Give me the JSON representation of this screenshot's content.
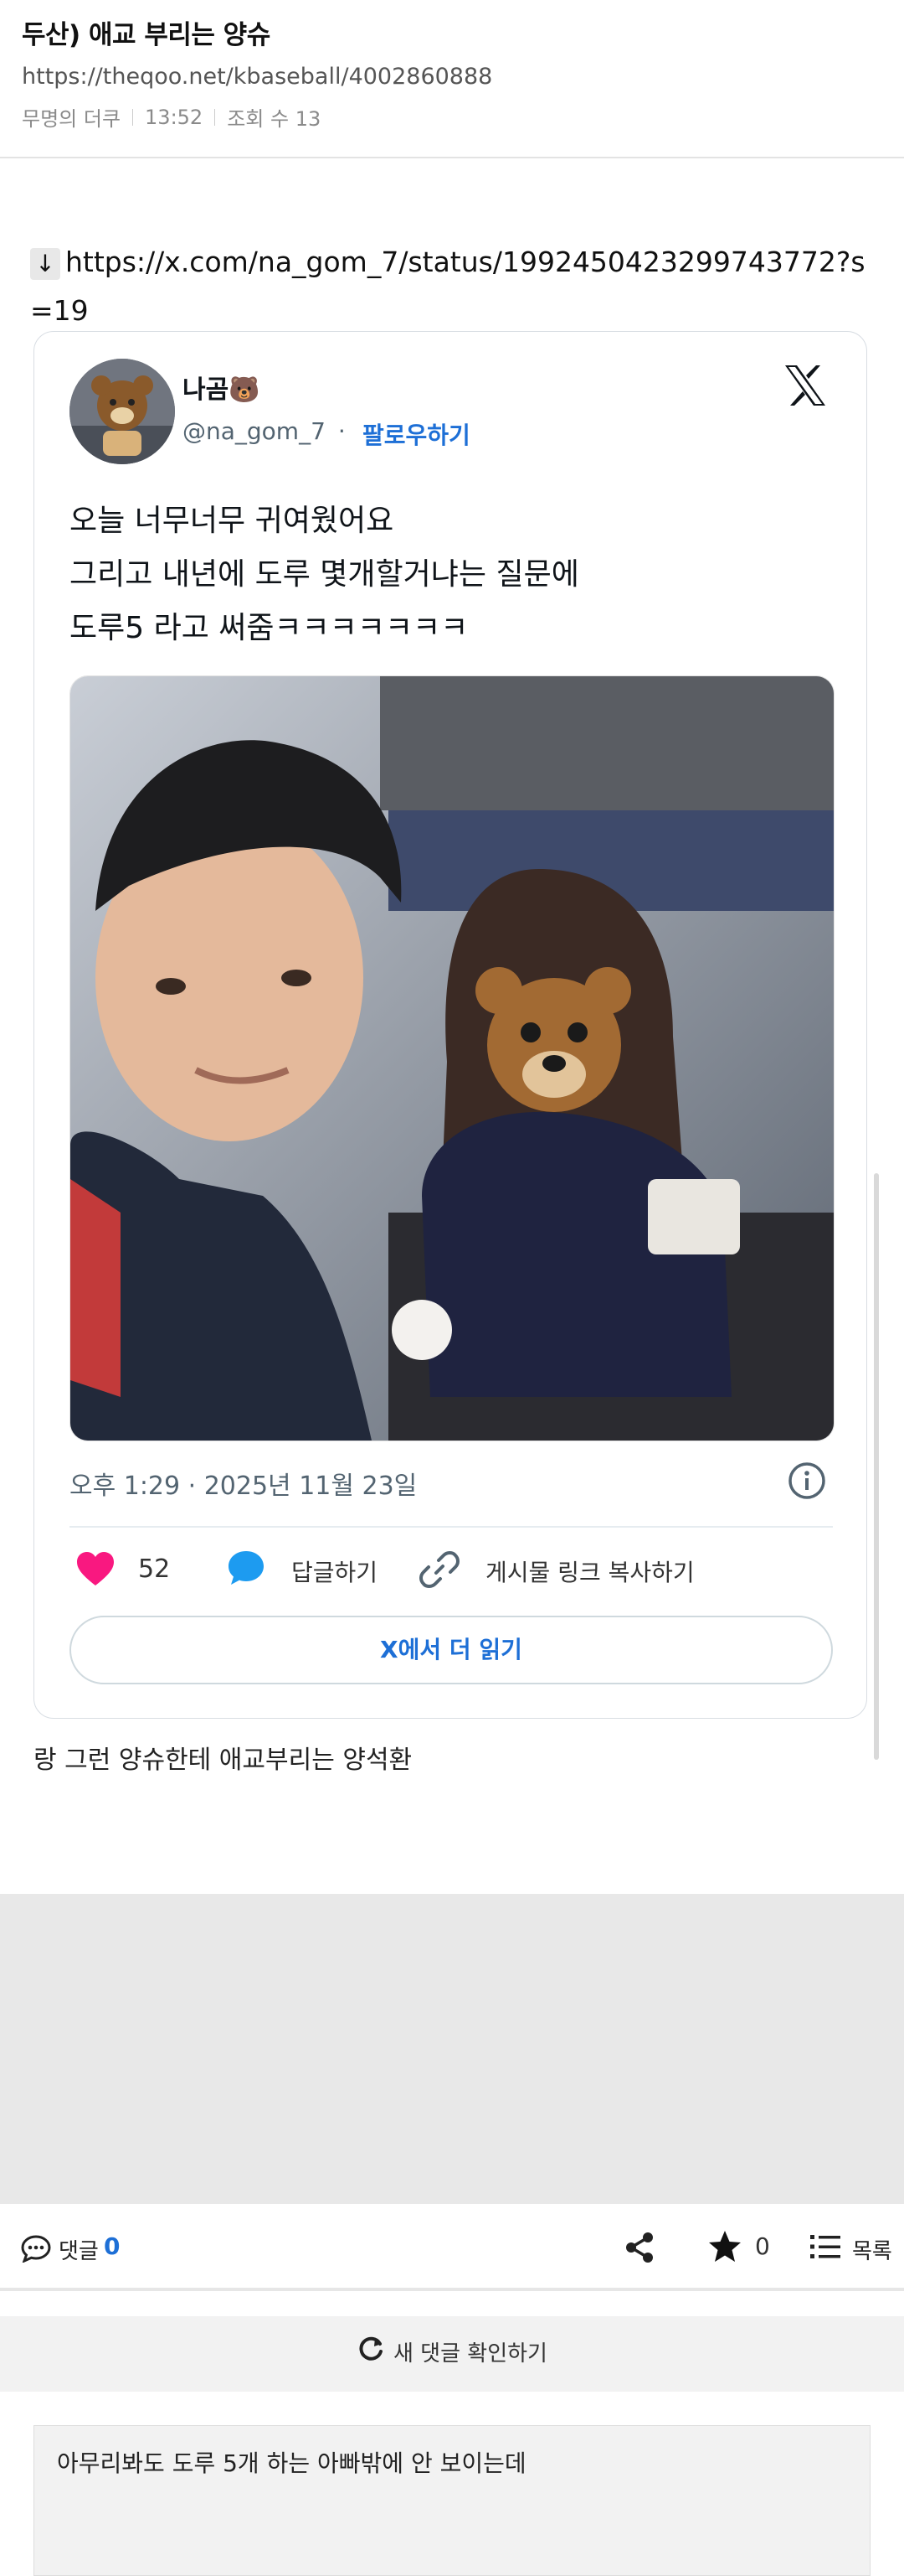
{
  "post": {
    "title": "두산) 애교 부리는 양슈",
    "url": "https://theqoo.net/kbaseball/4002860888",
    "author": "무명의 더쿠",
    "time": "13:52",
    "views_label": "조회 수 13"
  },
  "link": {
    "arrow": "↓",
    "url": "https://x.com/na_gom_7/status/1992450423299743772?s=19"
  },
  "tweet": {
    "display_name": "나곰🐻",
    "handle": "@na_gom_7",
    "separator": "·",
    "follow": "팔로우하기",
    "text_lines": [
      "오늘 너무너무 귀여웠어요",
      "그리고 내년에 도루 몇개할거냐는 질문에",
      "도루5 라고 써줌ㅋㅋㅋㅋㅋㅋㅋ"
    ],
    "timestamp": "오후 1:29 · 2025년 11월 23일",
    "likes": "52",
    "reply": "답글하기",
    "copy_link": "게시물 링크 복사하기",
    "read_more": "X에서 더 읽기",
    "colors": {
      "accent": "#1d6fd6",
      "like": "#f91880",
      "reply": "#1d9bf0"
    }
  },
  "body_text": "랑 그런 양슈한테 애교부리는 양석환",
  "bottom_bar": {
    "comment_label": "댓글",
    "comment_count": "0",
    "star_count": "0",
    "list_label": "목록"
  },
  "refresh": {
    "label": "새 댓글 확인하기"
  },
  "comment": {
    "text": "아무리봐도 도루 5개 하는 아빠밖에 안 보이는데"
  },
  "icons": [
    "arrow-down-icon",
    "x-logo-icon",
    "info-icon",
    "heart-icon",
    "speech-bubble-icon",
    "link-icon",
    "comment-icon",
    "share-icon",
    "star-icon",
    "list-icon",
    "refresh-icon"
  ]
}
